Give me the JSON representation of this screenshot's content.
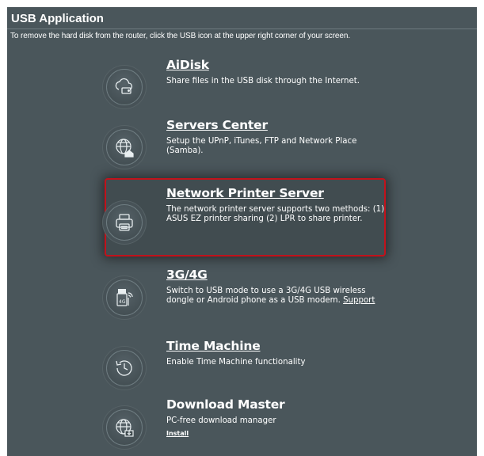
{
  "page": {
    "title": "USB Application",
    "subtitle": "To remove the hard disk from the router, click the USB icon at the upper right corner of your screen."
  },
  "apps": [
    {
      "name": "AiDisk",
      "icon": "cloud-disk-icon",
      "description": "Share files in the USB disk through the Internet."
    },
    {
      "name": "Servers Center",
      "icon": "globe-house-icon",
      "description": "Setup the UPnP, iTunes, FTP and Network Place (Samba)."
    },
    {
      "name": "Network Printer Server",
      "icon": "printer-icon",
      "description": "The network printer server supports two methods: (1) ASUS EZ printer sharing (2) LPR to share printer.",
      "highlighted": true
    },
    {
      "name": "3G/4G",
      "icon": "usb-modem-icon",
      "description": "Switch to USB mode to use a 3G/4G USB wireless dongle or Android phone as a USB modem.",
      "link": "Support"
    },
    {
      "name": "Time Machine",
      "icon": "clock-arrow-icon",
      "description": "Enable Time Machine functionality"
    },
    {
      "name": "Download Master",
      "icon": "globe-download-icon",
      "description": "PC-free download manager",
      "link": "Install"
    }
  ],
  "colors": {
    "panel_bg": "#4a565b",
    "highlight_border": "#c1121b",
    "text": "#ffffff"
  }
}
